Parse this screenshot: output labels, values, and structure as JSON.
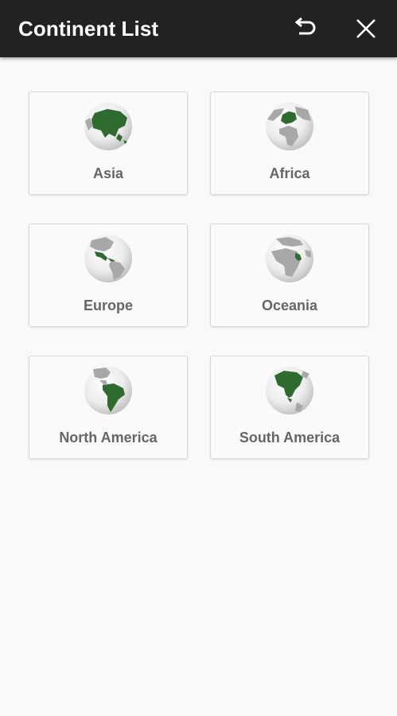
{
  "app_bar": {
    "title": "Continent List",
    "undo_icon": "undo-icon",
    "close_icon": "close-icon",
    "background": "#222222"
  },
  "continents": [
    {
      "label": "Asia",
      "icon": "globe-asia-icon"
    },
    {
      "label": "Africa",
      "icon": "globe-europe-icon"
    },
    {
      "label": "Europe",
      "icon": "globe-central-america-icon"
    },
    {
      "label": "Oceania",
      "icon": "globe-east-africa-icon"
    },
    {
      "label": "North America",
      "icon": "globe-south-america-icon"
    },
    {
      "label": "South America",
      "icon": "globe-north-america-icon"
    }
  ],
  "colors": {
    "land_highlight": "#2e6b2e",
    "land_other": "#a8a8a8",
    "label_text": "#666666"
  }
}
